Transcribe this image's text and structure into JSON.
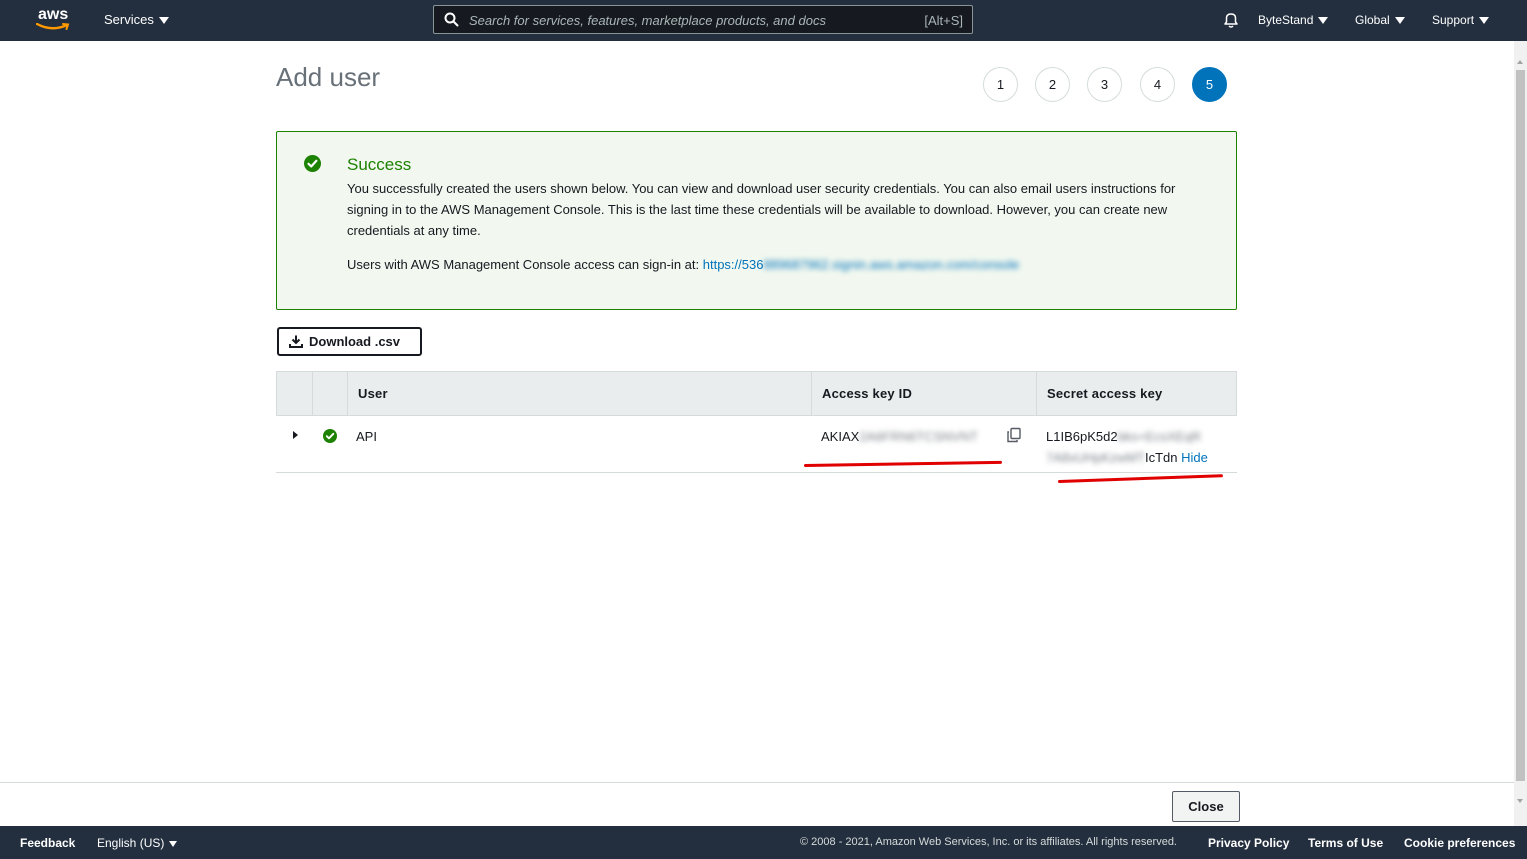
{
  "topnav": {
    "logo": "aws",
    "services_label": "Services",
    "search_placeholder": "Search for services, features, marketplace products, and docs",
    "search_shortcut": "[Alt+S]",
    "account_label": "ByteStand",
    "region_label": "Global",
    "support_label": "Support",
    "icons": [
      "search-icon",
      "bell-icon",
      "caret-down-icon"
    ]
  },
  "page": {
    "title": "Add user",
    "steps": [
      "1",
      "2",
      "3",
      "4",
      "5"
    ],
    "active_step": "5"
  },
  "success": {
    "title": "Success",
    "message": "You successfully created the users shown below. You can view and download user security credentials. You can also email users instructions for signing in to the AWS Management Console. This is the last time these credentials will be available to download. However, you can create new credentials at any time.",
    "signin_prefix": "Users with AWS Management Console access can sign-in at: ",
    "signin_url_visible": "https://536",
    "signin_url_blurred": "889687962.signin.aws.amazon.com/console"
  },
  "download_button": "Download .csv",
  "table": {
    "headers": [
      "User",
      "Access key ID",
      "Secret access key"
    ],
    "rows": [
      {
        "user": "API",
        "access_key_visible": "AKIAX",
        "access_key_blurred": "2A6FRN6TCSNVNT",
        "secret_line1_visible": "L1IB6pK5d2",
        "secret_line1_blurred": "bks+EcsXEqR",
        "secret_line2_blurred": "7A8xUHpKzwMT",
        "secret_line2_visible": "IcTdn",
        "hide_label": "Hide"
      }
    ]
  },
  "close_button": "Close",
  "footer": {
    "feedback": "Feedback",
    "language": "English (US)",
    "copyright": "© 2008 - 2021, Amazon Web Services, Inc. or its affiliates. All rights reserved.",
    "privacy": "Privacy Policy",
    "terms": "Terms of Use",
    "cookies": "Cookie preferences"
  },
  "colors": {
    "nav_bg": "#232f3e",
    "success_green": "#1d8102",
    "link_blue": "#0073bb",
    "annotation_red": "#e00000"
  }
}
